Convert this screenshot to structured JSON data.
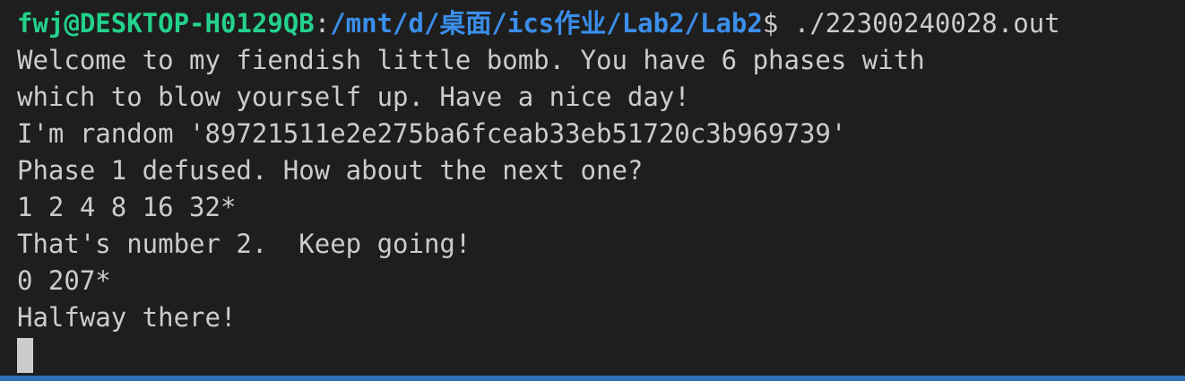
{
  "prompt": {
    "user_host": "fwj@DESKTOP-H0129QB",
    "separator": ":",
    "cwd": "/mnt/d/桌面/ics作业/Lab2/Lab2",
    "symbol": "$",
    "command": " ./22300240028.out"
  },
  "output_lines": [
    "Welcome to my fiendish little bomb. You have 6 phases with",
    "which to blow yourself up. Have a nice day!",
    "I'm random '89721511e2e275ba6fceab33eb51720c3b969739'",
    "Phase 1 defused. How about the next one?",
    "1 2 4 8 16 32*",
    "That's number 2.  Keep going!",
    "0 207*",
    "Halfway there!"
  ],
  "colors": {
    "background": "#1e1e1e",
    "text": "#cccccc",
    "user_host": "#23d18b",
    "path": "#3b8eea",
    "status_bar": "#2f6fb4"
  }
}
